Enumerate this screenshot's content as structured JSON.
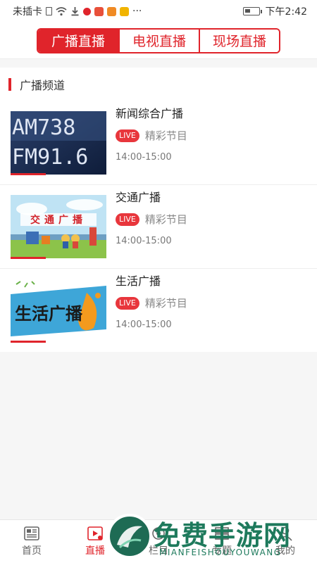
{
  "status_bar": {
    "carrier": "未插卡",
    "time": "下午2:42",
    "more": "···"
  },
  "header": {
    "tabs": [
      {
        "label": "广播直播",
        "active": true
      },
      {
        "label": "电视直播",
        "active": false
      },
      {
        "label": "现场直播",
        "active": false
      }
    ]
  },
  "section": {
    "title": "广播频道"
  },
  "channels": [
    {
      "name": "新闻综合广播",
      "live_badge": "LIVE",
      "program": "精彩节目",
      "time": "14:00-15:00",
      "thumb_text_1": "AM738",
      "thumb_text_2": "FM91.6"
    },
    {
      "name": "交通广播",
      "live_badge": "LIVE",
      "program": "精彩节目",
      "time": "14:00-15:00",
      "thumb_text": "交通广播"
    },
    {
      "name": "生活广播",
      "live_badge": "LIVE",
      "program": "精彩节目",
      "time": "14:00-15:00",
      "thumb_text": "生活广播"
    }
  ],
  "tabbar": {
    "items": [
      {
        "label": "首页",
        "icon": "news-icon",
        "active": false
      },
      {
        "label": "直播",
        "icon": "live-video-icon",
        "active": true
      },
      {
        "label": "栏目",
        "icon": "column-icon",
        "active": false
      },
      {
        "label": "专题",
        "icon": "topic-icon",
        "active": false
      },
      {
        "label": "我的",
        "icon": "profile-icon",
        "active": false
      }
    ]
  },
  "watermark": {
    "text": "免费手游网",
    "sub": "MIANFEISHOUYOUWANG"
  },
  "colors": {
    "accent": "#e0242b",
    "live_badge": "#e8363c",
    "watermark": "#1e7a5c"
  }
}
